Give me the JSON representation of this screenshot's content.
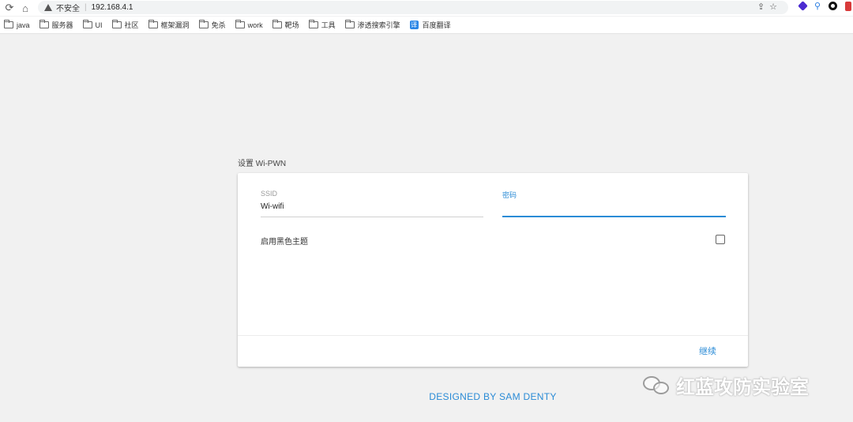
{
  "browser": {
    "security_label": "不安全",
    "url": "192.168.4.1",
    "bookmarks": [
      {
        "label": "java"
      },
      {
        "label": "服务器"
      },
      {
        "label": "UI"
      },
      {
        "label": "社区"
      },
      {
        "label": "框架漏洞"
      },
      {
        "label": "免杀"
      },
      {
        "label": "work"
      },
      {
        "label": "靶场"
      },
      {
        "label": "工具"
      },
      {
        "label": "渗透搜索引擎"
      }
    ],
    "translate_bookmark": {
      "icon_text": "译",
      "label": "百度翻译"
    }
  },
  "page": {
    "section_title": "设置 Wi-PWN",
    "ssid": {
      "label": "SSID",
      "value": "Wi-wifi"
    },
    "password": {
      "label": "密码",
      "value": ""
    },
    "dark_theme_label": "启用黑色主题",
    "dark_theme_checked": false,
    "continue_label": "继续",
    "footer_credit": "DESIGNED BY SAM DENTY"
  },
  "watermark": {
    "text": "红蓝攻防实验室"
  },
  "colors": {
    "accent": "#2a8bd6",
    "background": "#f1f1f1"
  }
}
